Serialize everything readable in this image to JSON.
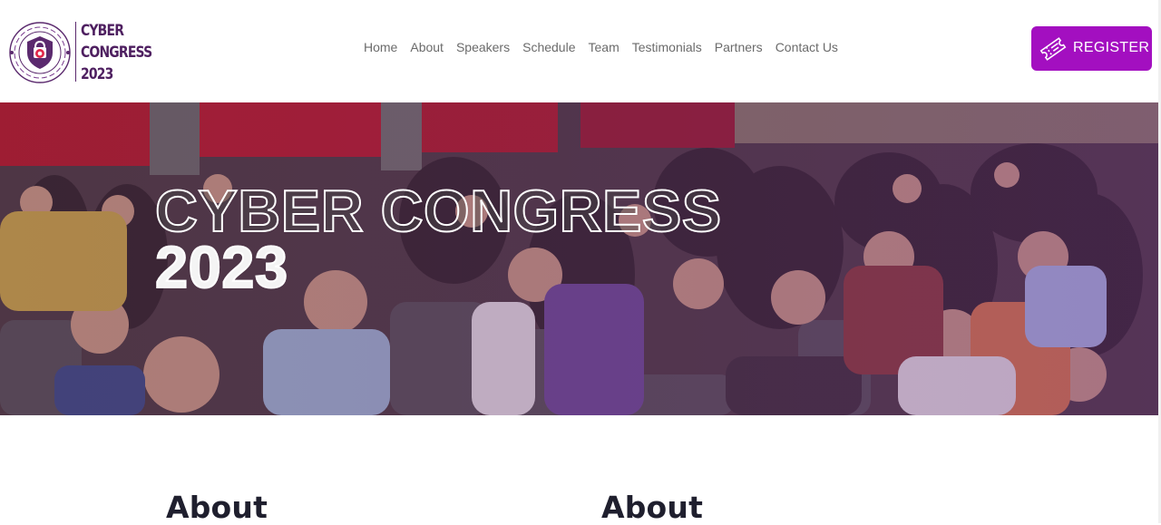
{
  "logo": {
    "line1": "CYBER",
    "line2": "CONGRESS",
    "line3": "2023"
  },
  "nav": {
    "items": [
      "Home",
      "About",
      "Speakers",
      "Schedule",
      "Team",
      "Testimonials",
      "Partners",
      "Contact Us"
    ]
  },
  "register": {
    "label": "REGISTER",
    "icon": "ticket-icon"
  },
  "hero": {
    "title_line1": "CYBER CONGRESS",
    "title_line2": "2023"
  },
  "about": {
    "left_heading": "About",
    "right_heading": "About"
  },
  "colors": {
    "accent": "#a30fc0",
    "brand_dark": "#4e1f60",
    "nav_text": "#6b6b6b"
  }
}
